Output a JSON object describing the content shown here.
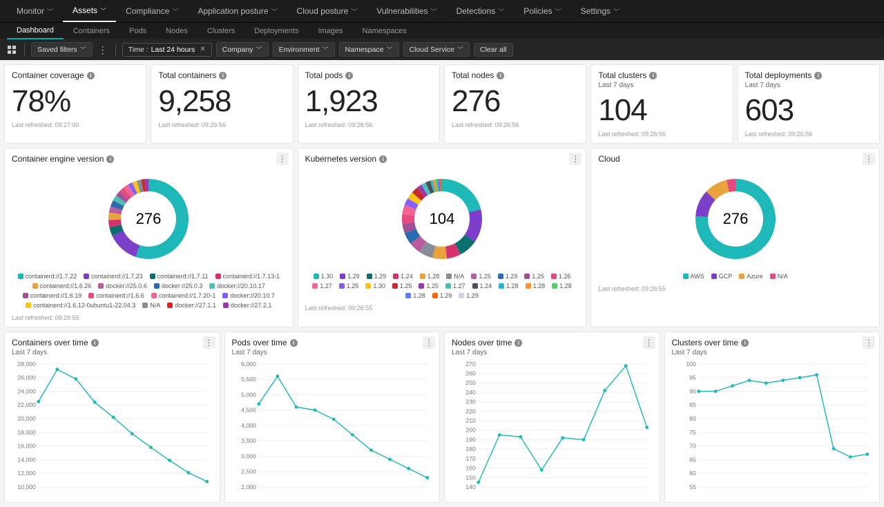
{
  "topnav": [
    {
      "label": "Monitor"
    },
    {
      "label": "Assets",
      "active": true
    },
    {
      "label": "Compliance"
    },
    {
      "label": "Application posture"
    },
    {
      "label": "Cloud posture"
    },
    {
      "label": "Vulnerabilities"
    },
    {
      "label": "Detections"
    },
    {
      "label": "Policies"
    },
    {
      "label": "Settings"
    }
  ],
  "subnav": [
    {
      "label": "Dashboard",
      "active": true
    },
    {
      "label": "Containers"
    },
    {
      "label": "Pods"
    },
    {
      "label": "Nodes"
    },
    {
      "label": "Clusters"
    },
    {
      "label": "Deployments"
    },
    {
      "label": "Images"
    },
    {
      "label": "Namespaces"
    }
  ],
  "filters": {
    "saved": "Saved filters",
    "time_label": "Time :",
    "time_value": "Last 24 hours",
    "chips": [
      "Company",
      "Environment",
      "Namespace",
      "Cloud Service"
    ],
    "clear": "Clear all"
  },
  "kpis": [
    {
      "title": "Container coverage",
      "value": "78%",
      "refresh": "Last refreshed: 09:27:00"
    },
    {
      "title": "Total containers",
      "value": "9,258",
      "refresh": "Last refreshed: 09:26:56"
    },
    {
      "title": "Total pods",
      "value": "1,923",
      "refresh": "Last refreshed: 09:26:56"
    },
    {
      "title": "Total nodes",
      "value": "276",
      "refresh": "Last refreshed: 09:26:56"
    },
    {
      "title": "Total clusters",
      "sub": "Last 7 days",
      "value": "104",
      "refresh": "Last refreshed: 09:26:56"
    },
    {
      "title": "Total deployments",
      "sub": "Last 7 days",
      "value": "603",
      "refresh": "Last refreshed: 09:26:56"
    }
  ],
  "donuts": [
    {
      "title": "Container engine version",
      "center": "276",
      "refresh": "Last refreshed: 09:26:55",
      "legend": [
        "containerd://1.7.22",
        "containerd://1.7.23",
        "containerd://1.7.11",
        "containerd://1.7.13-1",
        "containerd://1.6.26",
        "docker://25.0.6",
        "docker://25.0.3",
        "docker://20.10.17",
        "containerd://1.6.19",
        "containerd://1.6.6",
        "containerd://1.7.20-1",
        "docker://20.10.7",
        "containerd://1.6.12-0ubuntu1-22.04.3",
        "N/A",
        "docker://27.1.1",
        "docker://27.2.1"
      ]
    },
    {
      "title": "Kubernetes version",
      "center": "104",
      "refresh": "Last refreshed: 09:26:55",
      "legend": [
        "1.30",
        "1.29",
        "1.29",
        "1.24",
        "1.28",
        "N/A",
        "1.25",
        "1.29",
        "1.25",
        "1.26",
        "1.27",
        "1.25",
        "1.30",
        "1.25",
        "1.25",
        "1.27",
        "1.24",
        "1.28",
        "1.28",
        "1.28",
        "1.28",
        "1.29",
        "1.29"
      ]
    },
    {
      "title": "Cloud",
      "center": "276",
      "refresh": "Last refreshed: 09:26:55",
      "legend": [
        "AWS",
        "GCP",
        "Azure",
        "N/A"
      ]
    }
  ],
  "linecharts": [
    {
      "title": "Containers over time",
      "sub": "Last 7 days"
    },
    {
      "title": "Pods over time",
      "sub": "Last 7 days"
    },
    {
      "title": "Nodes over time",
      "sub": "Last 7 days"
    },
    {
      "title": "Clusters over time",
      "sub": "Last 7 days"
    }
  ],
  "chart_data": [
    {
      "type": "pie",
      "title": "Container engine version",
      "total": 276,
      "series": [
        {
          "name": "containerd://1.7.22",
          "value": 150,
          "color": "#1fb8b8"
        },
        {
          "name": "containerd://1.7.23",
          "value": 35,
          "color": "#7b3fc9"
        },
        {
          "name": "containerd://1.7.11",
          "value": 10,
          "color": "#0d6e6e"
        },
        {
          "name": "containerd://1.7.13-1",
          "value": 8,
          "color": "#d6336c"
        },
        {
          "name": "containerd://1.6.26",
          "value": 8,
          "color": "#e8a33d"
        },
        {
          "name": "docker://25.0.6",
          "value": 7,
          "color": "#b85c9e"
        },
        {
          "name": "docker://25.0.3",
          "value": 7,
          "color": "#2b6cb0"
        },
        {
          "name": "docker://20.10.17",
          "value": 6,
          "color": "#4dc0b5"
        },
        {
          "name": "containerd://1.6.19",
          "value": 6,
          "color": "#a05195"
        },
        {
          "name": "containerd://1.6.6",
          "value": 6,
          "color": "#e64980"
        },
        {
          "name": "containerd://1.7.20-1",
          "value": 6,
          "color": "#f06595"
        },
        {
          "name": "docker://20.10.7",
          "value": 5,
          "color": "#845ef7"
        },
        {
          "name": "containerd://1.6.12-0ubuntu1-22.04.3",
          "value": 5,
          "color": "#fcc419"
        },
        {
          "name": "N/A",
          "value": 5,
          "color": "#868e96"
        },
        {
          "name": "docker://27.1.1",
          "value": 4,
          "color": "#c92a2a"
        },
        {
          "name": "docker://27.2.1",
          "value": 4,
          "color": "#9c36b5"
        }
      ]
    },
    {
      "type": "pie",
      "title": "Kubernetes version",
      "total": 104,
      "series": [
        {
          "name": "1.30",
          "value": 22,
          "color": "#1fb8b8"
        },
        {
          "name": "1.29",
          "value": 14,
          "color": "#7b3fc9"
        },
        {
          "name": "1.29",
          "value": 8,
          "color": "#0d6e6e"
        },
        {
          "name": "1.24",
          "value": 6,
          "color": "#d6336c"
        },
        {
          "name": "1.28",
          "value": 6,
          "color": "#e8a33d"
        },
        {
          "name": "N/A",
          "value": 6,
          "color": "#868e96"
        },
        {
          "name": "1.25",
          "value": 5,
          "color": "#b85c9e"
        },
        {
          "name": "1.29",
          "value": 5,
          "color": "#2b6cb0"
        },
        {
          "name": "1.25",
          "value": 4,
          "color": "#a05195"
        },
        {
          "name": "1.26",
          "value": 4,
          "color": "#e64980"
        },
        {
          "name": "1.27",
          "value": 4,
          "color": "#f06595"
        },
        {
          "name": "1.25",
          "value": 3,
          "color": "#845ef7"
        },
        {
          "name": "1.30",
          "value": 3,
          "color": "#fcc419"
        },
        {
          "name": "1.25",
          "value": 3,
          "color": "#c92a2a"
        },
        {
          "name": "1.25",
          "value": 2,
          "color": "#9c36b5"
        },
        {
          "name": "1.27",
          "value": 2,
          "color": "#4dc0b5"
        },
        {
          "name": "1.24",
          "value": 2,
          "color": "#495057"
        },
        {
          "name": "1.28",
          "value": 1,
          "color": "#22b8cf"
        },
        {
          "name": "1.28",
          "value": 1,
          "color": "#ff922b"
        },
        {
          "name": "1.28",
          "value": 1,
          "color": "#51cf66"
        },
        {
          "name": "1.28",
          "value": 1,
          "color": "#5c7cfa"
        },
        {
          "name": "1.29",
          "value": 1,
          "color": "#f76707"
        },
        {
          "name": "1.29",
          "value": 0,
          "color": "#ced4da"
        }
      ]
    },
    {
      "type": "pie",
      "title": "Cloud",
      "total": 276,
      "series": [
        {
          "name": "AWS",
          "value": 210,
          "color": "#1fb8b8"
        },
        {
          "name": "GCP",
          "value": 30,
          "color": "#7b3fc9"
        },
        {
          "name": "Azure",
          "value": 26,
          "color": "#e8a33d"
        },
        {
          "name": "N/A",
          "value": 10,
          "color": "#e64980"
        }
      ]
    },
    {
      "type": "line",
      "title": "Containers over time",
      "ylim": [
        10000,
        28000
      ],
      "yticks": [
        28000,
        26000,
        24000,
        22000,
        20000,
        18000,
        16000,
        14000,
        12000,
        10000
      ],
      "values": [
        22500,
        27200,
        25800,
        22400,
        20200,
        17800,
        15800,
        13900,
        12100,
        10800
      ]
    },
    {
      "type": "line",
      "title": "Pods over time",
      "ylim": [
        2000,
        6000
      ],
      "yticks": [
        6000,
        5500,
        5000,
        4500,
        4000,
        3500,
        3000,
        2500,
        2000
      ],
      "values": [
        4700,
        5600,
        4600,
        4500,
        4200,
        3700,
        3200,
        2900,
        2600,
        2300
      ]
    },
    {
      "type": "line",
      "title": "Nodes over time",
      "ylim": [
        140,
        270
      ],
      "yticks": [
        270,
        260,
        250,
        240,
        230,
        220,
        210,
        200,
        190,
        180,
        170,
        160,
        150,
        140
      ],
      "values": [
        145,
        195,
        193,
        158,
        192,
        190,
        242,
        268,
        203
      ]
    },
    {
      "type": "line",
      "title": "Clusters over time",
      "ylim": [
        55,
        100
      ],
      "yticks": [
        100,
        95,
        90,
        85,
        80,
        75,
        70,
        65,
        60,
        55
      ],
      "values": [
        90,
        90,
        92,
        94,
        93,
        94,
        95,
        96,
        69,
        66,
        67
      ]
    }
  ]
}
